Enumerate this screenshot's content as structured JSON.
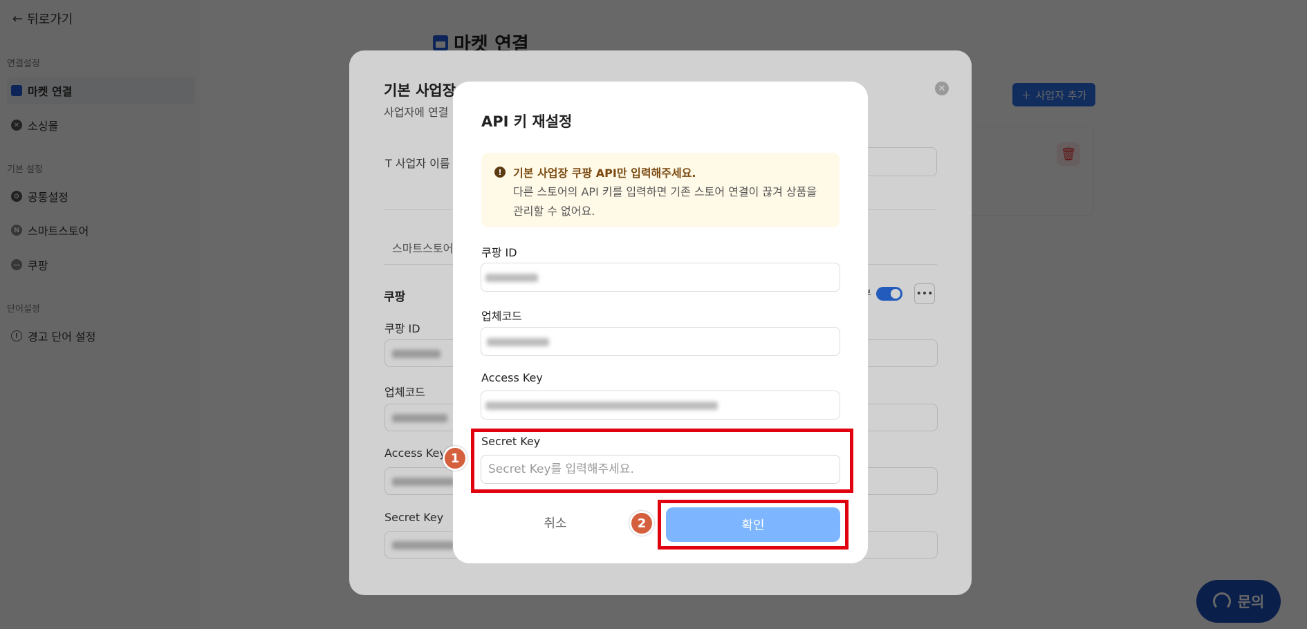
{
  "sidebar": {
    "back_label": "뒤로가기",
    "sections": [
      {
        "title": "연결설정",
        "items": [
          {
            "label": "마켓 연결",
            "active": true
          },
          {
            "label": "소싱몰"
          }
        ]
      },
      {
        "title": "기본 설정",
        "items": [
          {
            "label": "공통설정"
          },
          {
            "label": "스마트스토어"
          },
          {
            "label": "쿠팡"
          }
        ]
      },
      {
        "title": "단어설정",
        "items": [
          {
            "label": "경고 단어 설정"
          }
        ]
      }
    ]
  },
  "page": {
    "title": "마켓 연결",
    "add_business_label": "사업자 추가"
  },
  "business_modal": {
    "title": "기본 사업장",
    "subtitle": "사업자에 연결",
    "name_label": "사업자 이름",
    "tab_label": "스마트스토어",
    "section_title": "쿠팡",
    "toggle_label": "부",
    "fields": [
      {
        "label": "쿠팡 ID"
      },
      {
        "label": "업체코드"
      },
      {
        "label": "Access Key"
      },
      {
        "label": "Secret Key"
      }
    ]
  },
  "dialog": {
    "title": "API 키 재설정",
    "notice": {
      "heading": "기본 사업장 쿠팡 API만 입력해주세요.",
      "body": "다른 스토어의 API 키를 입력하면 기존 스토어 연결이 끊겨 상품을 관리할 수 없어요."
    },
    "fields": {
      "coupang_id": {
        "label": "쿠팡 ID"
      },
      "vendor_code": {
        "label": "업체코드"
      },
      "access_key": {
        "label": "Access Key"
      },
      "secret_key": {
        "label": "Secret Key",
        "value": "",
        "placeholder": "Secret Key를 입력해주세요."
      }
    },
    "cancel_label": "취소",
    "confirm_label": "확인"
  },
  "annotations": {
    "step1": "1",
    "step2": "2",
    "color": "#e0000e"
  },
  "chat": {
    "label": "문의"
  },
  "colors": {
    "primary": "#2b6fe6",
    "confirm_disabled": "#7db6ff",
    "notice_bg": "#fff9e8",
    "notice_text": "#7a4a10"
  }
}
